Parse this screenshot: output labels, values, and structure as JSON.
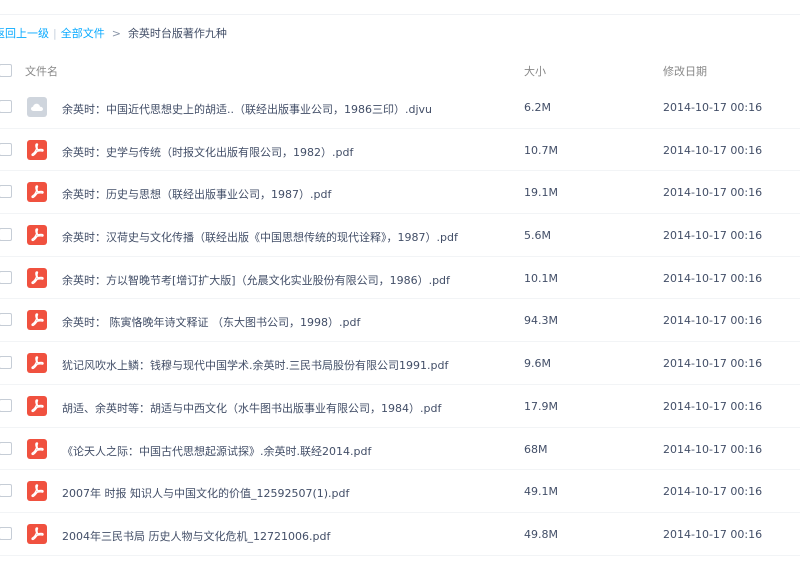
{
  "breadcrumb": {
    "back": "返回上一级",
    "separator": "|",
    "root": "全部文件",
    "arrow": ">",
    "current": "余英时台版著作九种"
  },
  "table": {
    "headers": {
      "name": "文件名",
      "size": "大小",
      "date": "修改日期"
    },
    "rows": [
      {
        "icon": "cloud-file-icon",
        "name": "余英时：中国近代思想史上的胡适..（联经出版事业公司，1986三印）.djvu",
        "size": "6.2M",
        "date": "2014-10-17 00:16"
      },
      {
        "icon": "pdf-icon",
        "name": "余英时：史学与传统（时报文化出版有限公司，1982）.pdf",
        "size": "10.7M",
        "date": "2014-10-17 00:16"
      },
      {
        "icon": "pdf-icon",
        "name": "余英时：历史与思想（联经出版事业公司，1987）.pdf",
        "size": "19.1M",
        "date": "2014-10-17 00:16"
      },
      {
        "icon": "pdf-icon",
        "name": "余英时：汉荷史与文化传播（联经出版《中国思想传统的现代诠释》，1987）.pdf",
        "size": "5.6M",
        "date": "2014-10-17 00:16"
      },
      {
        "icon": "pdf-icon",
        "name": "余英时：方以智晚节考[增订扩大版]（允晨文化实业股份有限公司，1986）.pdf",
        "size": "10.1M",
        "date": "2014-10-17 00:16"
      },
      {
        "icon": "pdf-icon",
        "name": "余英时： 陈寅恪晚年诗文释证 （东大图书公司，1998）.pdf",
        "size": "94.3M",
        "date": "2014-10-17 00:16"
      },
      {
        "icon": "pdf-icon",
        "name": "犹记风吹水上鳞：钱穆与现代中国学术.余英时.三民书局股份有限公司1991.pdf",
        "size": "9.6M",
        "date": "2014-10-17 00:16"
      },
      {
        "icon": "pdf-icon",
        "name": "胡适、余英时等：胡适与中西文化（水牛图书出版事业有限公司，1984）.pdf",
        "size": "17.9M",
        "date": "2014-10-17 00:16"
      },
      {
        "icon": "pdf-icon",
        "name": "《论天人之际：中国古代思想起源试探》.余英时.联经2014.pdf",
        "size": "68M",
        "date": "2014-10-17 00:16"
      },
      {
        "icon": "pdf-icon",
        "name": "2007年 时报 知识人与中国文化的价值_12592507(1).pdf",
        "size": "49.1M",
        "date": "2014-10-17 00:16"
      },
      {
        "icon": "pdf-icon",
        "name": "2004年三民书局 历史人物与文化危机_12721006.pdf",
        "size": "49.8M",
        "date": "2014-10-17 00:16"
      }
    ]
  },
  "colors": {
    "link": "#09aaff",
    "text": "#424e67",
    "header_text": "#888888",
    "pdf_icon": "#f0513f",
    "cloud_icon": "#cfd5dd"
  }
}
